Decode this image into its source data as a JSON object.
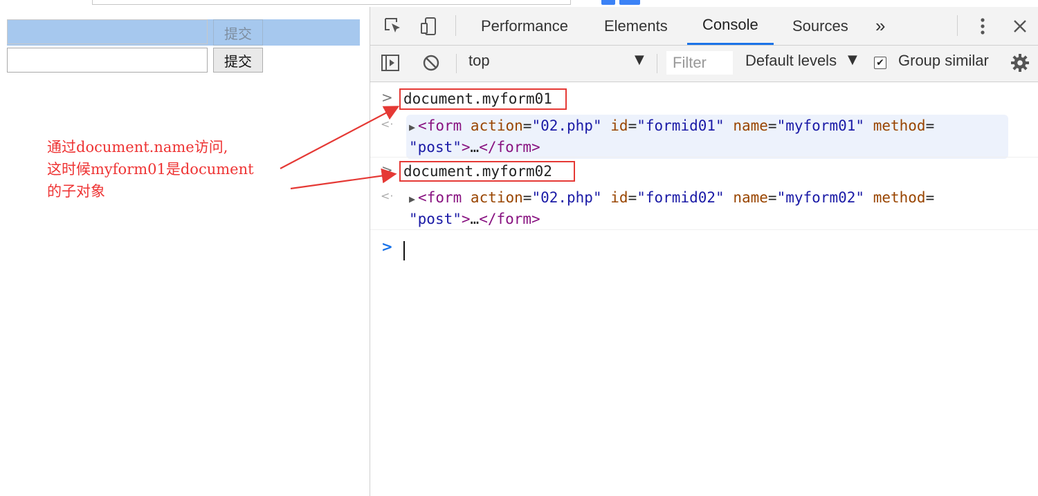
{
  "page": {
    "submit_button_1": "提交",
    "submit_button_2": "提交"
  },
  "annotation": {
    "line1": "通过document.name访问,",
    "line2": "这时候myform01是document",
    "line3": "的子对象"
  },
  "devtools": {
    "tabs": [
      "Performance",
      "Elements",
      "Console",
      "Sources"
    ],
    "active_tab": "Console",
    "more_tabs": "»",
    "context": "top",
    "filter_placeholder": "Filter",
    "levels": "Default levels",
    "group_similar_label": "Group similar",
    "group_similar_checked": true
  },
  "console": {
    "entries": [
      {
        "command": "document.myform01",
        "result": {
          "tag": "form",
          "action": "02.php",
          "id": "formid01",
          "name": "myform01",
          "method": "post"
        }
      },
      {
        "command": "document.myform02",
        "result": {
          "tag": "form",
          "action": "02.php",
          "id": "formid02",
          "name": "myform02",
          "method": "post"
        }
      }
    ]
  },
  "colors": {
    "annotation_red": "#e33",
    "highlight_box": "#e53935",
    "active_tab_underline": "#1a73e8"
  }
}
